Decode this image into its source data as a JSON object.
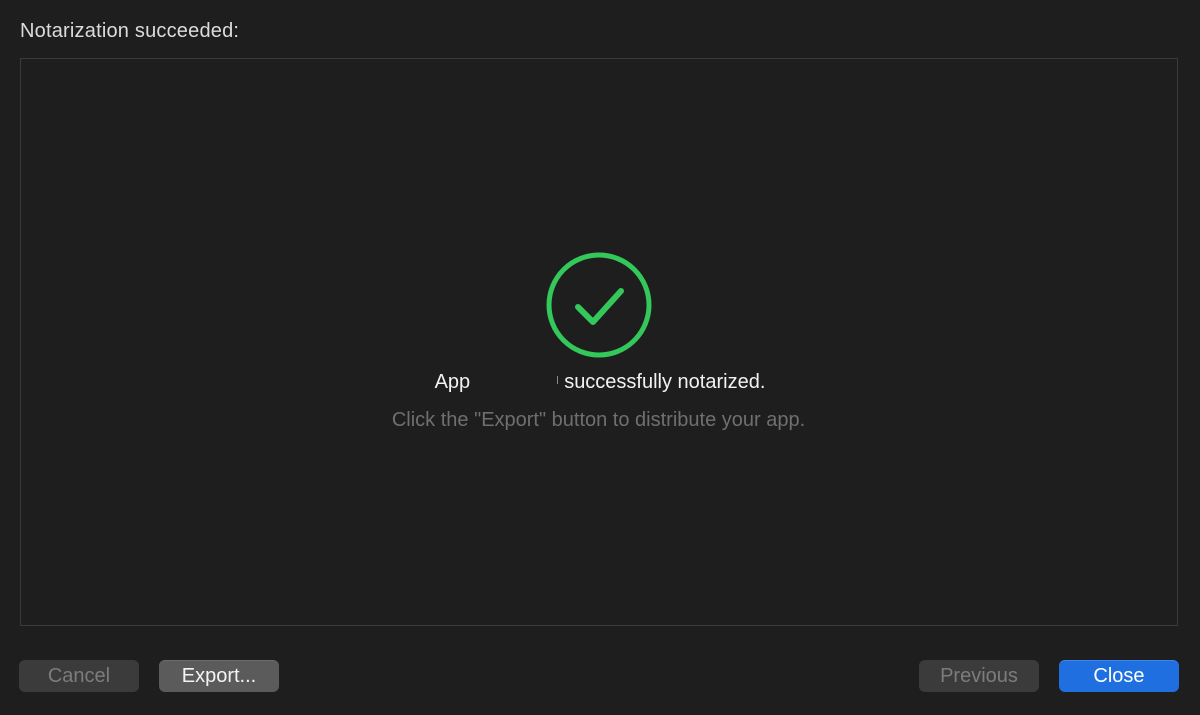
{
  "header": {
    "title": "Notarization succeeded:"
  },
  "content": {
    "icon": "checkmark-circle-icon",
    "icon_color": "#34c759",
    "message_prefix": "App",
    "message_suffix": "successfully notarized.",
    "sub_message": "Click the \"Export\" button to distribute your app."
  },
  "buttons": {
    "cancel_label": "Cancel",
    "export_label": "Export...",
    "previous_label": "Previous",
    "close_label": "Close"
  },
  "colors": {
    "accent": "#1f6fe0",
    "background": "#1e1e1e"
  }
}
